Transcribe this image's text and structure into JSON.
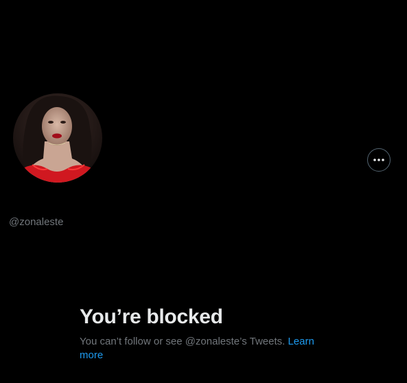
{
  "profile": {
    "handle": "@zonaleste",
    "more_icon": "ellipsis-icon"
  },
  "blocked": {
    "title": "You’re blocked",
    "message": "You can’t follow or see @zonaleste’s Tweets. ",
    "learn_more": "Learn more"
  },
  "colors": {
    "background": "#000000",
    "primary_text": "#e7e9ea",
    "secondary_text": "#71767b",
    "link": "#1d9bf0",
    "border": "#536471"
  }
}
